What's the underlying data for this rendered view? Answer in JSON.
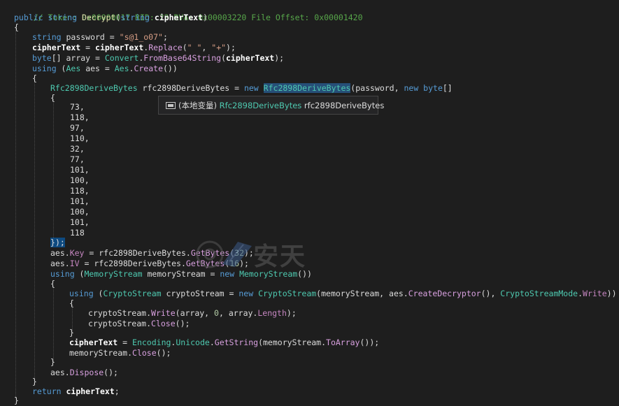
{
  "header_comment": "// Token: 0x06000017 RID: 23 RVA: 0x00003220 File Offset: 0x00001420",
  "method_sig": {
    "kw_public": "public",
    "kw_string": "string",
    "name": "Decrypt",
    "open": "(",
    "kw_param_type": "string",
    "param": "cipherText",
    "close": ")"
  },
  "code": {
    "open_brace": "{",
    "close_brace": "}",
    "l_password_kw": "string",
    "l_password_rest": " password = ",
    "l_password_val": "\"s@1_o07\"",
    "l_cipher_lhs": "cipherText",
    "l_cipher_eq": " = ",
    "l_cipher_obj": "cipherText",
    "l_cipher_dot": ".",
    "l_cipher_method": "Replace",
    "l_cipher_args_open": "(",
    "l_cipher_arg1": "\" \"",
    "l_cipher_comma": ", ",
    "l_cipher_arg2": "\"+\"",
    "l_cipher_end": ");",
    "l_byte_kw": "byte",
    "l_byte_rest": "[] array = ",
    "l_byte_type": "Convert",
    "l_byte_dot": ".",
    "l_byte_method": "FromBase64String",
    "l_byte_open": "(",
    "l_byte_arg": "cipherText",
    "l_byte_end": ");",
    "l_using_kw": "using",
    "l_using_open": " (",
    "l_using_type": "Aes",
    "l_using_var": " aes = ",
    "l_using_type2": "Aes",
    "l_using_dot": ".",
    "l_using_method": "Create",
    "l_using_end": "())",
    "l_rfc_type": "Rfc2898DeriveBytes",
    "l_rfc_var": " rfc2898DeriveBytes = ",
    "l_rfc_new": "new",
    "l_rfc_space": " ",
    "l_rfc_ctor": "Rfc2898DeriveBytes",
    "l_rfc_args": "(password, ",
    "l_rfc_new2": "new",
    "l_rfc_byte": " byte",
    "l_rfc_brackets": "[]",
    "bytes": [
      "73,",
      "118,",
      "97,",
      "110,",
      "32,",
      "77,",
      "101,",
      "100,",
      "118,",
      "101,",
      "100,",
      "101,",
      "118"
    ],
    "l_bytes_close_brace": "}",
    "l_bytes_close_paren": ");",
    "l_key_obj": "aes.",
    "l_key_prop": "Key",
    "l_key_rest": " = rfc2898DeriveBytes.",
    "l_key_method": "GetBytes",
    "l_key_open": "(",
    "l_key_num": "32",
    "l_key_end": ");",
    "l_iv_obj": "aes.",
    "l_iv_prop": "IV",
    "l_iv_rest": " = rfc2898DeriveBytes.",
    "l_iv_method": "GetBytes",
    "l_iv_open": "(",
    "l_iv_num": "16",
    "l_iv_end": ");",
    "l_ms_kw": "using",
    "l_ms_open": " (",
    "l_ms_type": "MemoryStream",
    "l_ms_var": " memoryStream = ",
    "l_ms_new": "new",
    "l_ms_space": " ",
    "l_ms_type2": "MemoryStream",
    "l_ms_end": "())",
    "l_cs_kw": "using",
    "l_cs_open": " (",
    "l_cs_type": "CryptoStream",
    "l_cs_var": " cryptoStream = ",
    "l_cs_new": "new",
    "l_cs_space": " ",
    "l_cs_type2": "CryptoStream",
    "l_cs_args1": "(memoryStream, aes.",
    "l_cs_method": "CreateDecryptor",
    "l_cs_args2": "(), ",
    "l_cs_enum": "CryptoStreamMode",
    "l_cs_dot": ".",
    "l_cs_member": "Write",
    "l_cs_end": "))",
    "l_write_obj": "cryptoStream.",
    "l_write_method": "Write",
    "l_write_args": "(array, ",
    "l_write_num": "0",
    "l_write_args2": ", array.",
    "l_write_prop": "Length",
    "l_write_end": ");",
    "l_close_obj": "cryptoStream.",
    "l_close_method": "Close",
    "l_close_end": "();",
    "l_ct_lhs": "cipherText",
    "l_ct_eq": " = ",
    "l_ct_type": "Encoding",
    "l_ct_dot": ".",
    "l_ct_prop": "Unicode",
    "l_ct_dot2": ".",
    "l_ct_method": "GetString",
    "l_ct_args": "(memoryStream.",
    "l_ct_method2": "ToArray",
    "l_ct_end": "());",
    "l_msclose_obj": "memoryStream.",
    "l_msclose_method": "Close",
    "l_msclose_end": "();",
    "l_dispose_obj": "aes.",
    "l_dispose_method": "Dispose",
    "l_dispose_end": "();",
    "l_return_kw": "return",
    "l_return_space": " ",
    "l_return_val": "cipherText",
    "l_return_end": ";"
  },
  "tooltip": {
    "icon": "local-variable-icon",
    "prefix": "(本地变量) ",
    "type": "Rfc2898DeriveBytes",
    "name": " rfc2898DeriveBytes"
  },
  "watermark": {
    "text": "安天"
  },
  "colors": {
    "background": "#1e1e1e",
    "comment": "#57a64a",
    "keyword": "#569cd6",
    "type": "#4ec9b0",
    "method": "#dcdcaa",
    "string": "#d69d85",
    "number": "#b5cea8",
    "selection": "#264f78"
  }
}
